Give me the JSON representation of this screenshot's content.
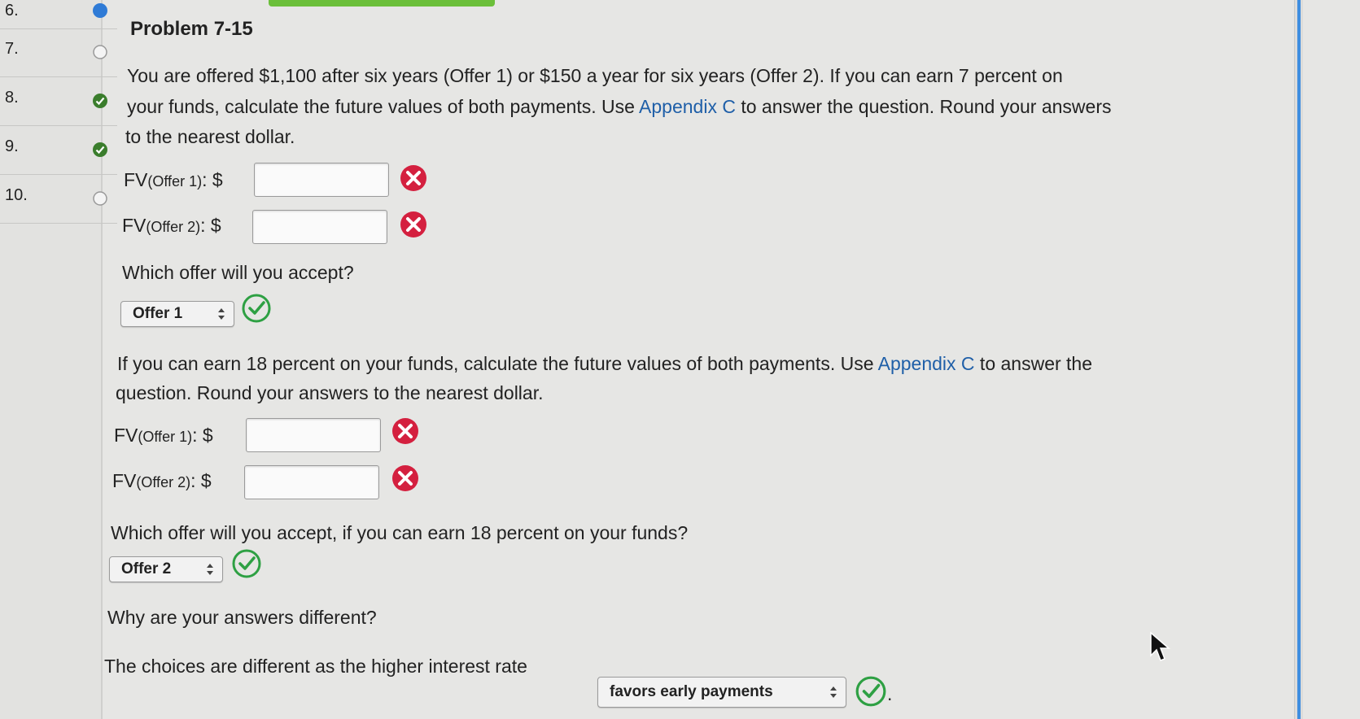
{
  "sidebar": {
    "questions": [
      {
        "number": "6.",
        "status": "current"
      },
      {
        "number": "7.",
        "status": "unanswered"
      },
      {
        "number": "8.",
        "status": "answered"
      },
      {
        "number": "9.",
        "status": "answered"
      },
      {
        "number": "10.",
        "status": "unanswered"
      }
    ]
  },
  "problem": {
    "title": "Problem 7-15",
    "intro_line1": "You are offered $1,100 after six years (Offer 1) or $150 a year for six years (Offer 2). If you can earn 7 percent on",
    "intro_line2_a": "your funds, calculate the future values of both payments. Use ",
    "intro_line2_link": "Appendix C",
    "intro_line2_b": " to answer the question. Round your answers",
    "intro_line3": "to the nearest dollar.",
    "part1": {
      "fv1_prefix": "FV",
      "fv1_sub": "(Offer 1)",
      "fv1_suffix": ": $",
      "fv1_value": "",
      "fv2_prefix": "FV",
      "fv2_sub": "(Offer 2)",
      "fv2_suffix": ": $",
      "fv2_value": "",
      "question": "Which offer will you accept?",
      "selected": "Offer 1"
    },
    "part2": {
      "line1": "If you can earn 18 percent on your funds, calculate the future values of both payments. Use ",
      "line1_link": "Appendix C",
      "line1_b": " to answer the",
      "line2": "question. Round your answers to the nearest dollar.",
      "fv1_prefix": "FV",
      "fv1_sub": "(Offer 1)",
      "fv1_suffix": ": $",
      "fv1_value": "",
      "fv2_prefix": "FV",
      "fv2_sub": "(Offer 2)",
      "fv2_suffix": ": $",
      "fv2_value": "",
      "question": "Which offer will you accept, if you can earn 18 percent on your funds?",
      "selected": "Offer 2"
    },
    "part3": {
      "question": "Why are your answers different?",
      "sentence_a": "The choices are different as the higher interest rate",
      "selected": "favors early payments",
      "sentence_end": "."
    }
  },
  "colors": {
    "correct": "#2ea043",
    "incorrect": "#d4203f",
    "link": "#1f5fa8",
    "current": "#2f7bd6",
    "scrollbar": "#3f8ee0"
  }
}
